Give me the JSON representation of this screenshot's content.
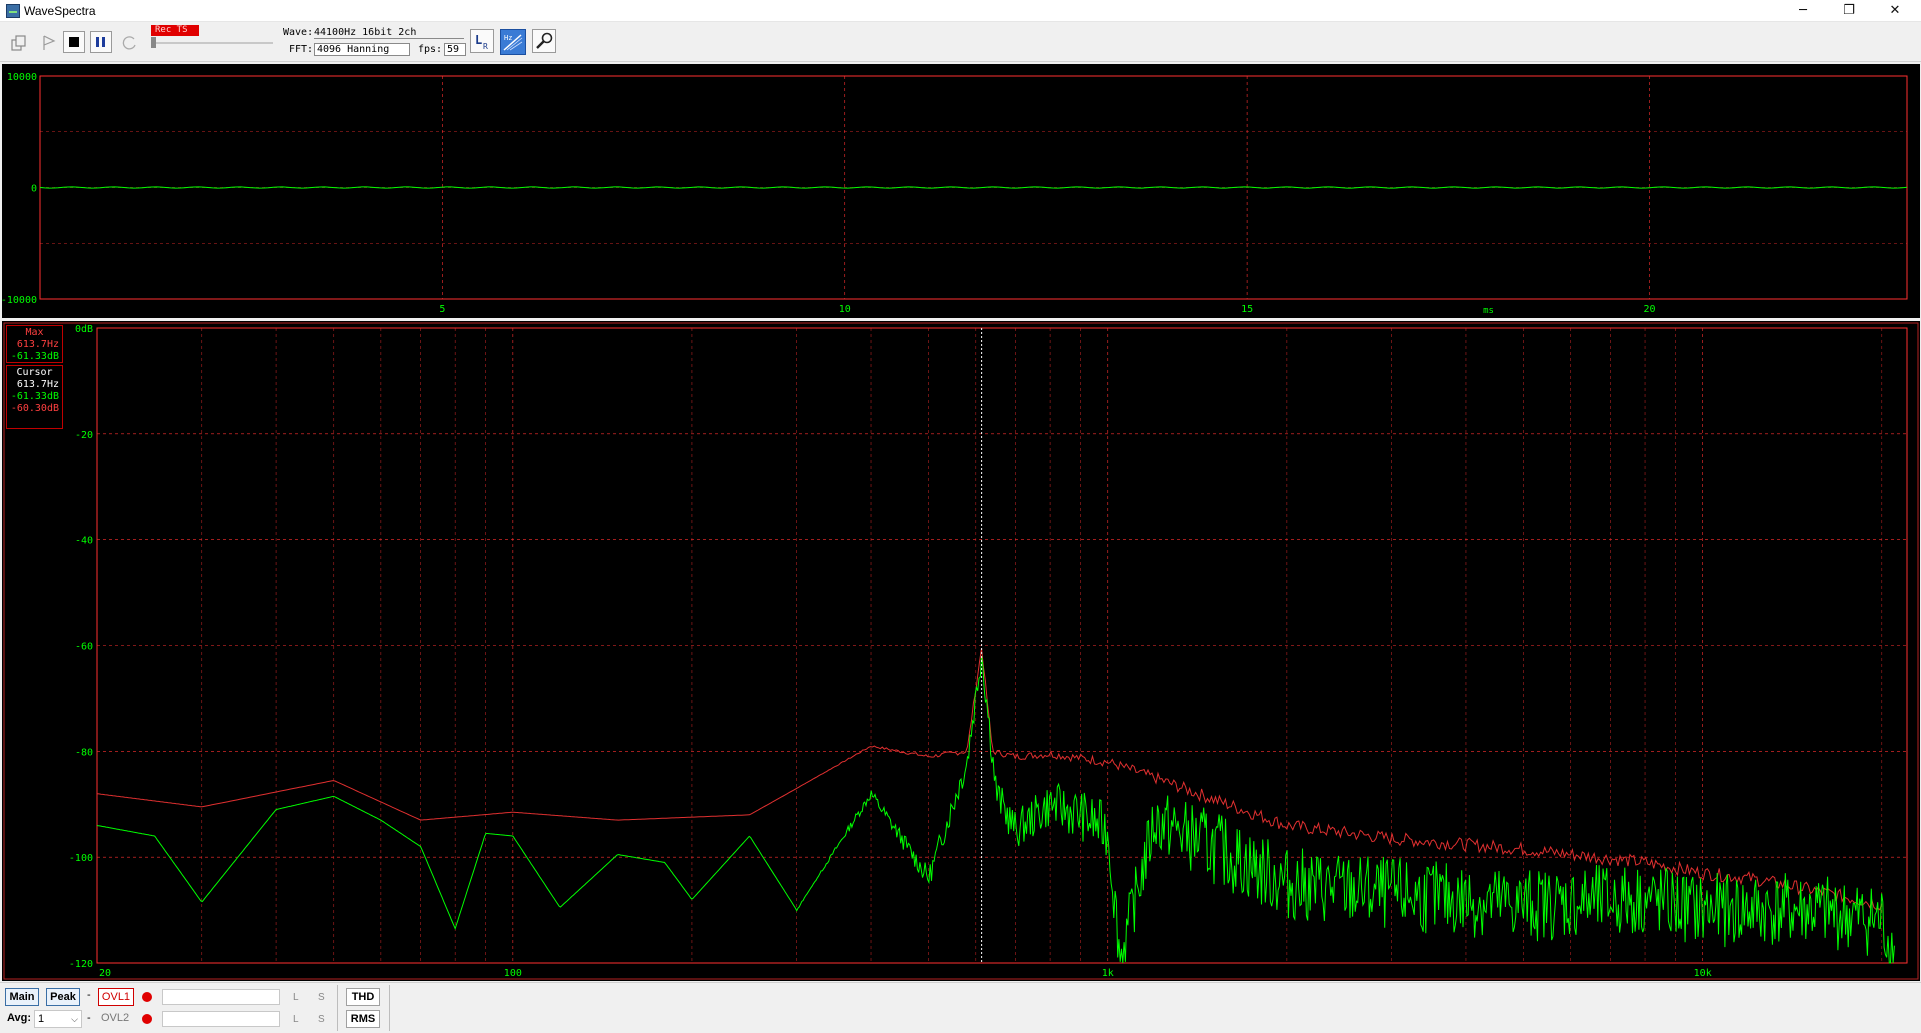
{
  "window": {
    "title": "WaveSpectra",
    "minimize": "─",
    "restore": "❐",
    "close": "✕"
  },
  "toolbar": {
    "rec_label": "Rec TS",
    "wave_label": "Wave:",
    "wave_value": "44100Hz 16bit 2ch",
    "fft_label": "FFT:",
    "fft_value": "4096 Hanning",
    "fps_label": "fps:",
    "fps_value": "59",
    "icons": [
      "copy-icon",
      "play-icon",
      "stop-icon",
      "pause-icon",
      "refresh-icon",
      "lr-channel-icon",
      "hz-scale-icon",
      "settings-wrench-icon"
    ]
  },
  "wave_plot": {
    "y_ticks": [
      "10000",
      "0",
      "-10000"
    ],
    "x_ticks": [
      "5",
      "10",
      "15",
      "20"
    ],
    "x_unit": "ms",
    "colors": {
      "grid": "#ff3030",
      "axis_text": "#00ff00",
      "trace": "#00ff00"
    }
  },
  "spectrum_plot": {
    "y_ticks": [
      "0dB",
      "-20",
      "-40",
      "-60",
      "-80",
      "-100",
      "-120"
    ],
    "x_ticks": [
      "20",
      "100",
      "1k",
      "10k"
    ],
    "cursor_hz": 613.7,
    "colors": {
      "grid": "#ff3030",
      "max_trace": "#e03030",
      "live_trace": "#00ff00",
      "cursor": "#ffffff"
    }
  },
  "info": {
    "max": {
      "label": "Max",
      "freq": "613.7Hz",
      "level": "-61.33dB"
    },
    "cursor": {
      "label": "Cursor",
      "freq": "613.7Hz",
      "level_live": "-61.33dB",
      "level_max": "-60.30dB"
    }
  },
  "statusbar": {
    "main": "Main",
    "peak": "Peak",
    "dash1": "-",
    "ovl1": "OVL1",
    "ovl2": "OVL2",
    "dash2": "-",
    "avg_label": "Avg:",
    "avg_value": "1",
    "l": "L",
    "s": "S",
    "thd": "THD",
    "rms": "RMS"
  },
  "chart_data": {
    "type": "line",
    "title": "",
    "xlabel": "",
    "ylabel": "",
    "x_scale": "log",
    "xlim": [
      20,
      22050
    ],
    "ylim": [
      -120,
      0
    ],
    "grid": true,
    "series": [
      {
        "name": "Max",
        "x": [
          20,
          30,
          50,
          70,
          100,
          150,
          250,
          300,
          400,
          500,
          580,
          613.7,
          640,
          700,
          800,
          1000,
          1200,
          1500,
          2000,
          3000,
          5000,
          8000,
          10000,
          12000,
          15000,
          20000
        ],
        "y": [
          -88,
          -90.5,
          -85.5,
          -93,
          -91.5,
          -93,
          -92,
          -87,
          -79,
          -81,
          -80,
          -60.3,
          -80,
          -81,
          -80.5,
          -82,
          -85,
          -89,
          -94,
          -96.5,
          -98.5,
          -101,
          -103,
          -104,
          -106,
          -109
        ]
      },
      {
        "name": "Live",
        "x": [
          20,
          25,
          30,
          40,
          50,
          60,
          70,
          80,
          90,
          100,
          120,
          150,
          180,
          200,
          250,
          300,
          400,
          500,
          580,
          613.7,
          650,
          700,
          800,
          900,
          1000,
          1050,
          1200,
          1500,
          2000,
          3000,
          5000,
          8000,
          10000,
          15000,
          20000,
          21000
        ],
        "y": [
          -94,
          -96,
          -108.5,
          -91,
          -88.5,
          -93,
          -98,
          -113.5,
          -95.5,
          -96,
          -109.5,
          -99.5,
          -101,
          -108,
          -96,
          -110,
          -88,
          -104,
          -82,
          -61.3,
          -88,
          -95,
          -90,
          -92,
          -95,
          -119,
          -93,
          -98,
          -105,
          -107,
          -109,
          -108,
          -110,
          -110,
          -112,
          -119
        ]
      }
    ],
    "wave_trace": {
      "xlim": [
        0,
        23.2
      ],
      "ylim": [
        -10000,
        10000
      ],
      "value": 0
    }
  }
}
